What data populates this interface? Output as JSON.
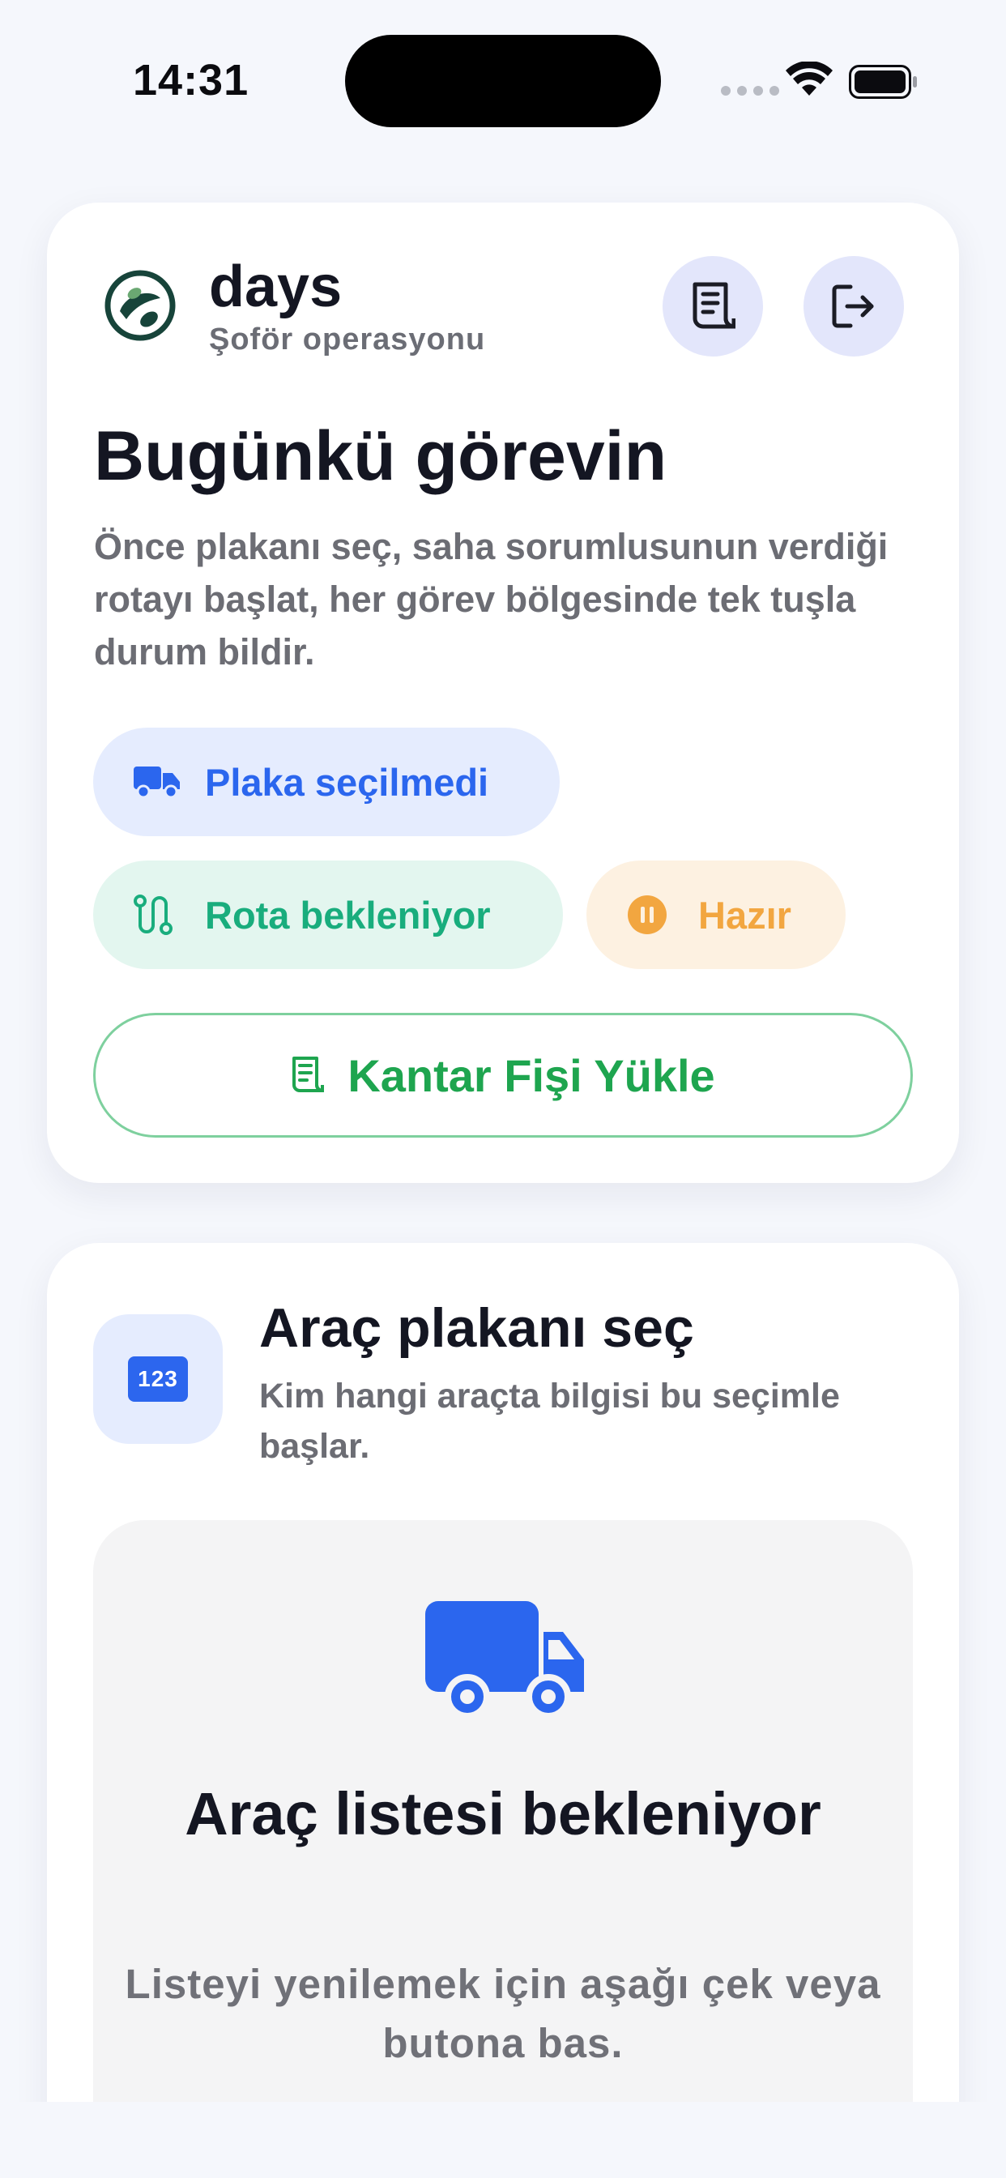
{
  "status_bar": {
    "time": "14:31",
    "icons": [
      "cellular-signal-icon",
      "wifi-icon",
      "battery-icon"
    ]
  },
  "header": {
    "brand_name": "days",
    "brand_subtitle": "Şoför operasyonu",
    "icons": [
      "days-logo-icon",
      "receipt-icon",
      "logout-icon"
    ]
  },
  "task": {
    "title": "Bugünkü görevin",
    "description": "Önce plakanı seç, saha sorumlusunun verdiği rotayı başlat, her görev bölgesinde tek tuşla durum bildir.",
    "pills": {
      "plate": {
        "label": "Plaka seçilmedi",
        "icon": "truck-icon",
        "color": "#2b66ee"
      },
      "route": {
        "label": "Rota bekleniyor",
        "icon": "route-icon",
        "color": "#19ad7d"
      },
      "status": {
        "label": "Hazır",
        "icon": "pause-icon",
        "color": "#f2a640"
      }
    },
    "upload_button": {
      "label": "Kantar Fişi Yükle",
      "icon": "receipt-icon",
      "color": "#1ea54f"
    }
  },
  "plate_section": {
    "icon_label": "123",
    "title": "Araç plakanı seç",
    "subtitle": "Kim hangi araçta bilgisi bu seçimle başlar.",
    "empty_state": {
      "icon": "truck-icon",
      "title": "Araç listesi bekleniyor",
      "subtitle": "Listeyi yenilemek için aşağı çek veya butona bas."
    }
  },
  "colors": {
    "background": "#f5f7fc",
    "accent_blue": "#2b66ee",
    "accent_green": "#19ad7d",
    "accent_orange": "#f2a640",
    "button_green": "#1ea54f"
  }
}
